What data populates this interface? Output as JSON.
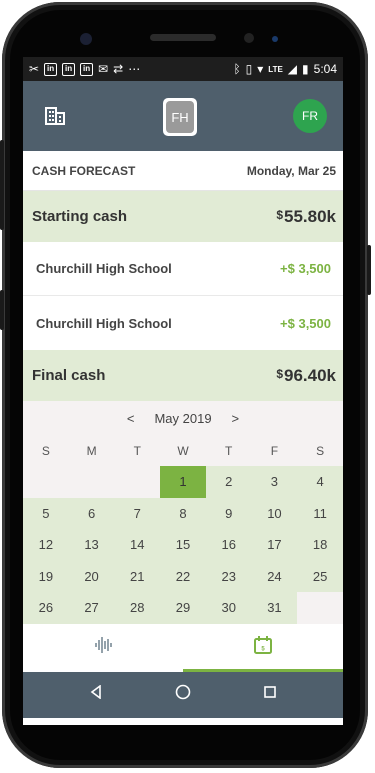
{
  "statusbar": {
    "network": "LTE",
    "time": "5:04"
  },
  "header": {
    "logo_initials": "FH",
    "avatar_initials": "FR"
  },
  "forecast": {
    "title": "CASH FORECAST",
    "date": "Monday, Mar 25",
    "starting": {
      "label": "Starting cash",
      "currency": "$",
      "amount": "55.80k"
    },
    "rows": [
      {
        "name": "Churchill High School",
        "amount": "+$ 3,500"
      },
      {
        "name": "Churchill High School",
        "amount": "+$ 3,500"
      }
    ],
    "final": {
      "label": "Final cash",
      "currency": "$",
      "amount": "96.40k"
    }
  },
  "calendar": {
    "prev": "<",
    "next": ">",
    "month_label": "May 2019",
    "weekdays": [
      "S",
      "M",
      "T",
      "W",
      "T",
      "F",
      "S"
    ],
    "selected_day": "1",
    "days": [
      "",
      "",
      "",
      "1",
      "2",
      "3",
      "4",
      "5",
      "6",
      "7",
      "8",
      "9",
      "10",
      "11",
      "12",
      "13",
      "14",
      "15",
      "16",
      "17",
      "18",
      "19",
      "20",
      "21",
      "22",
      "23",
      "24",
      "25",
      "26",
      "27",
      "28",
      "29",
      "30",
      "31",
      ""
    ]
  },
  "bottom_nav": {
    "tabs": [
      {
        "icon": "waveform-icon",
        "active": false
      },
      {
        "icon": "calendar-icon",
        "active": true
      }
    ]
  },
  "colors": {
    "appbar": "#4f5f6c",
    "accent_green": "#7cb342",
    "row_highlight": "#e1ebd5",
    "avatar": "#2ea44f"
  }
}
